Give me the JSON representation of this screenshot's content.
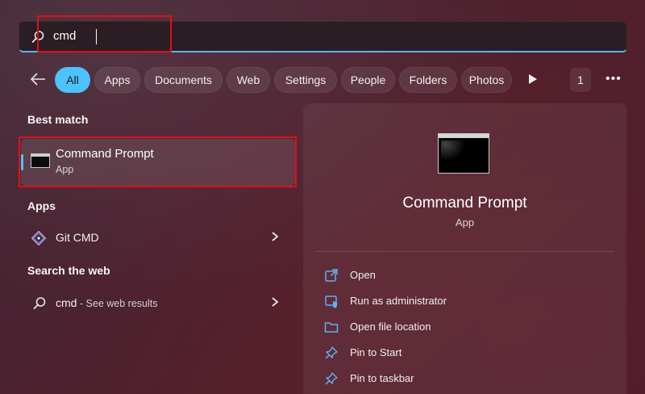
{
  "search": {
    "query": "cmd",
    "placeholder": ""
  },
  "filters": {
    "items": [
      {
        "label": "All",
        "active": true
      },
      {
        "label": "Apps"
      },
      {
        "label": "Documents"
      },
      {
        "label": "Web"
      },
      {
        "label": "Settings"
      },
      {
        "label": "People"
      },
      {
        "label": "Folders"
      },
      {
        "label": "Photos"
      }
    ],
    "count": "1",
    "more": "•••"
  },
  "sections": {
    "best_match": "Best match",
    "apps": "Apps",
    "search_web": "Search the web"
  },
  "best_match": {
    "title": "Command Prompt",
    "subtitle": "App"
  },
  "apps": [
    {
      "label": "Git CMD",
      "icon": "git-icon"
    }
  ],
  "web": {
    "query": "cmd",
    "suffix": " - See web results"
  },
  "detail": {
    "title": "Command Prompt",
    "subtitle": "App",
    "actions": [
      {
        "label": "Open",
        "icon": "open-icon"
      },
      {
        "label": "Run as administrator",
        "icon": "shield-icon"
      },
      {
        "label": "Open file location",
        "icon": "folder-icon"
      },
      {
        "label": "Pin to Start",
        "icon": "pin-icon"
      },
      {
        "label": "Pin to taskbar",
        "icon": "pin-icon"
      }
    ]
  },
  "colors": {
    "accent": "#4cc2ff",
    "highlight": "#e0101a",
    "background": "#4a2230"
  }
}
